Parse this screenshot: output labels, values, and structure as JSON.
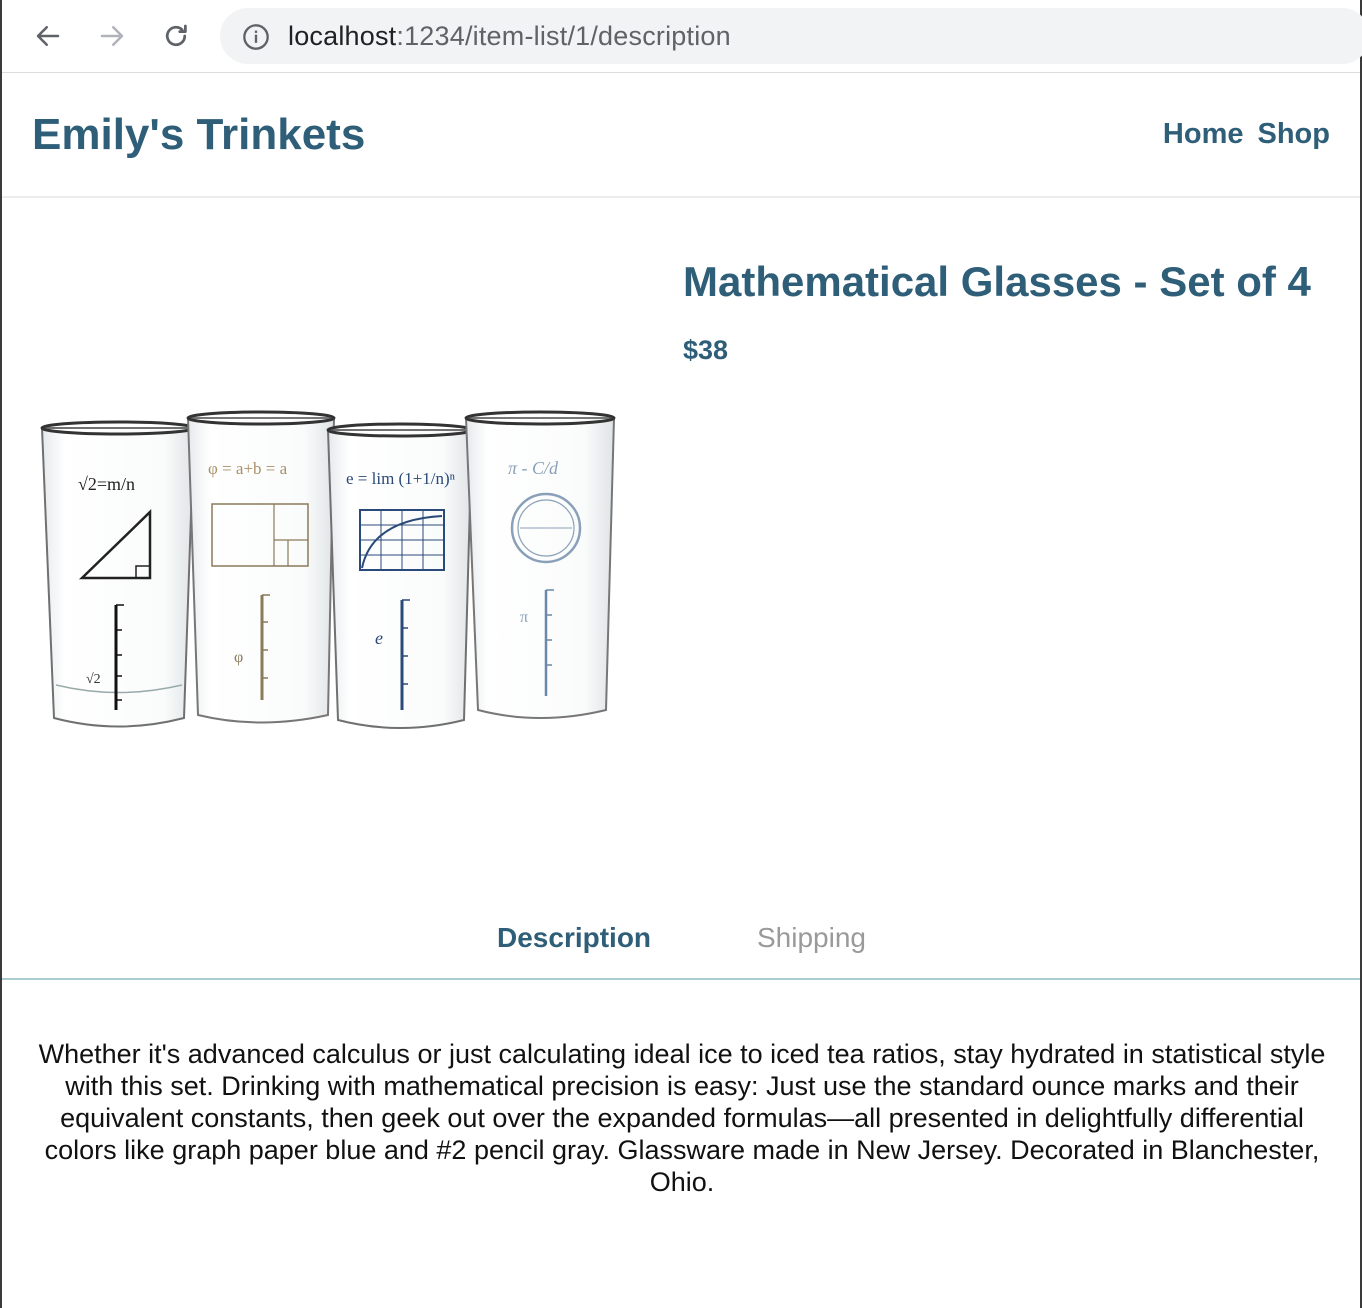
{
  "browser": {
    "url_host": "localhost",
    "url_path": ":1234/item-list/1/description",
    "icons": {
      "back": "arrow-left-icon",
      "forward": "arrow-right-icon",
      "reload": "reload-icon",
      "info": "info-circle-icon"
    }
  },
  "site": {
    "brand": "Emily's Trinkets",
    "nav": {
      "home": "Home",
      "shop": "Shop"
    },
    "accent_color": "#2f5e78"
  },
  "product": {
    "title": "Mathematical Glasses - Set of 4",
    "price": "$38",
    "image_alt": "Four drinking glasses with mathematical formulas"
  },
  "tabs": {
    "description": "Description",
    "shipping": "Shipping",
    "active": "description"
  },
  "description_text": "Whether it's advanced calculus or just calculating ideal ice to iced tea ratios, stay hydrated in statistical style with this set. Drinking with mathematical precision is easy: Just use the standard ounce marks and their equivalent constants, then geek out over the expanded formulas—all presented in delightfully differential colors like graph paper blue and #2 pencil gray. Glassware made in New Jersey. Decorated in Blanchester, Ohio."
}
